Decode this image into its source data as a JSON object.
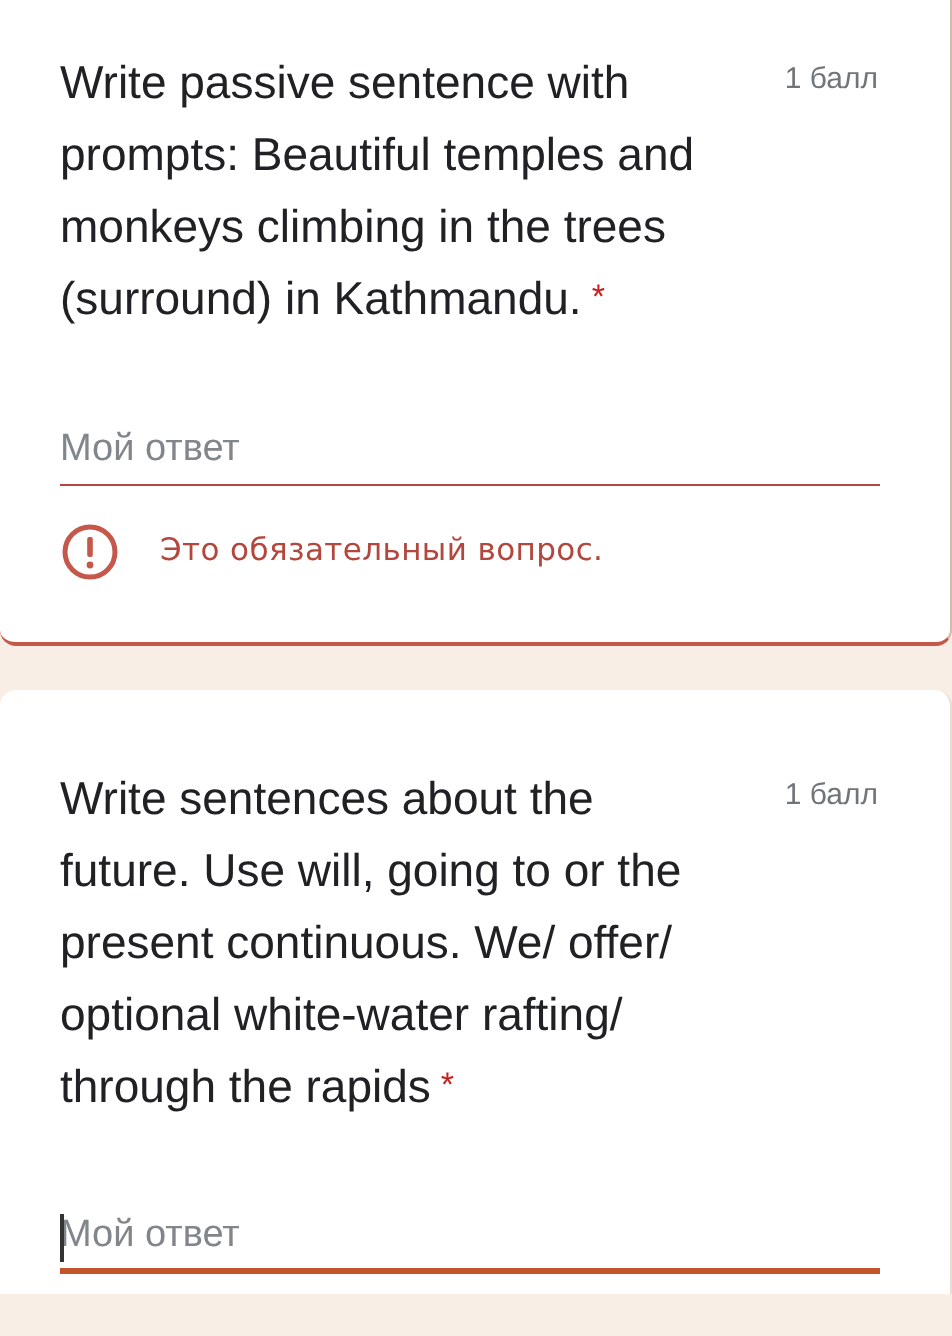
{
  "questions": [
    {
      "title": "Write passive sentence with prompts: Beautiful temples and monkeys climbing in the trees (surround) in Kathmandu.",
      "required_mark": "*",
      "points": "1 балл",
      "answer": {
        "placeholder": "Мой ответ",
        "focused": false
      },
      "error": "Это обязательный вопрос."
    },
    {
      "title": "Write sentences about the future. Use will, going to or the present continuous. We/ offer/ optional white-water rafting/ through the rapids",
      "required_mark": "*",
      "points": "1 балл",
      "answer": {
        "placeholder": "Мой ответ",
        "focused": true
      }
    }
  ]
}
